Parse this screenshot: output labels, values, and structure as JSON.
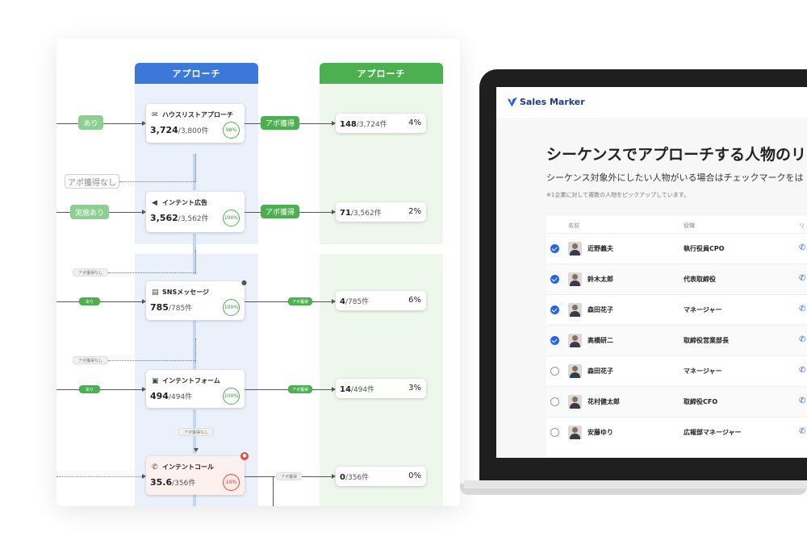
{
  "flow": {
    "columns": [
      {
        "header": "アプローチ"
      },
      {
        "header": "アプローチ"
      }
    ],
    "nodes": [
      {
        "icon": "mail-icon",
        "glyph": "✉",
        "title": "ハウスリストアプローチ",
        "count": "3,724",
        "total": "/3,800件",
        "rate": "98%",
        "rate_color": "green"
      },
      {
        "icon": "megaphone-icon",
        "glyph": "📢",
        "title": "インテント広告",
        "count": "3,562",
        "total": "/3,562件",
        "rate": "100%",
        "rate_color": "green"
      },
      {
        "icon": "message-icon",
        "glyph": "▤",
        "title": "SNSメッセージ",
        "count": "785",
        "total": "/785件",
        "rate": "100%",
        "rate_color": "green"
      },
      {
        "icon": "form-icon",
        "glyph": "▣",
        "title": "インテントフォーム",
        "count": "494",
        "total": "/494件",
        "rate": "100%",
        "rate_color": "green"
      },
      {
        "icon": "phone-icon",
        "glyph": "✆",
        "title": "インテントコール",
        "count": "35.6",
        "total": "/356件",
        "rate": "10%",
        "rate_color": "red"
      }
    ],
    "results": [
      {
        "count": "148",
        "total": "/3,724件",
        "pct": "4%"
      },
      {
        "count": "71",
        "total": "/3,562件",
        "pct": "2%"
      },
      {
        "count": "4",
        "total": "/785件",
        "pct": "6%"
      },
      {
        "count": "14",
        "total": "/494件",
        "pct": "3%"
      },
      {
        "count": "0",
        "total": "/356件",
        "pct": "0%"
      }
    ],
    "labels": {
      "ari_1": "あり",
      "jisshi_ari": "実施あり",
      "ari_3": "あり",
      "ari_4": "あり",
      "apo_1": "アポ獲得",
      "apo_2": "アポ獲得",
      "apo_3": "アポ獲得",
      "apo_4": "アポ獲得",
      "apo_5": "アポ獲得",
      "apo_nashi_1": "アポ獲得なし",
      "apo_nashi_2": "アポ獲得なし",
      "apo_nashi_3": "アポ獲得なし",
      "apo_nashi_4": "アポ獲得なし"
    }
  },
  "app": {
    "logo": "Sales Marker",
    "heading": "シーケンスでアプローチする人物のリ",
    "subheading": "シーケンス対象外にしたい人物がいる場合はチェックマークをは",
    "note": "※1企業に対して複数の人物をピックアップしています。",
    "columns": {
      "name": "名前",
      "role": "役職",
      "contact": "リ"
    },
    "people": [
      {
        "name": "近野義夫",
        "role": "執行役員CPO",
        "checked": true
      },
      {
        "name": "鈴木太郎",
        "role": "代表取締役",
        "checked": true
      },
      {
        "name": "森田花子",
        "role": "マネージャー",
        "checked": true
      },
      {
        "name": "高橋研二",
        "role": "取締役営業部長",
        "checked": true
      },
      {
        "name": "森田花子",
        "role": "マネージャー",
        "checked": false
      },
      {
        "name": "花村健太郎",
        "role": "取締役CFO",
        "checked": false
      },
      {
        "name": "安藤ゆり",
        "role": "広報部マネージャー",
        "checked": false
      }
    ],
    "colors": {
      "accent": "#2563eb",
      "blue_header": "#3b78d8",
      "green_header": "#4caf50"
    }
  }
}
